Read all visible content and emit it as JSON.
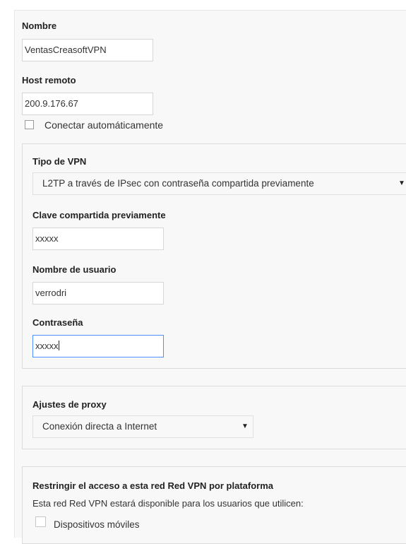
{
  "name": {
    "label": "Nombre",
    "value": "VentasCreasoftVPN"
  },
  "host": {
    "label": "Host remoto",
    "value": "200.9.176.67"
  },
  "auto_connect": {
    "label": "Conectar automáticamente",
    "checked": false
  },
  "vpn": {
    "type_label": "Tipo de VPN",
    "type_value": "L2TP a través de IPsec con contraseña compartida previamente",
    "psk_label": "Clave compartida previamente",
    "psk_value": "xxxxx",
    "user_label": "Nombre de usuario",
    "user_value": "verrodri",
    "pass_label": "Contraseña",
    "pass_value": "xxxxx"
  },
  "proxy": {
    "label": "Ajustes de proxy",
    "value": "Conexión directa a Internet"
  },
  "restrict": {
    "title": "Restringir el acceso a esta red Red VPN por plataforma",
    "description": "Esta red Red VPN estará disponible para los usuarios que utilicen:",
    "mobile_label": "Dispositivos móviles",
    "mobile_checked": false
  },
  "icons": {
    "dropdown": "triangle-down-icon"
  },
  "colors": {
    "focus_border": "#4d90fe",
    "panel_bg": "#f8f8f8"
  }
}
